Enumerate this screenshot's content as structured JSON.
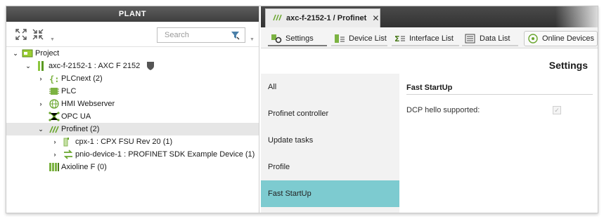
{
  "plant": {
    "title": "PLANT",
    "search_placeholder": "Search",
    "tree": [
      {
        "label": "Project",
        "icon": "project-icon",
        "toggle": "expanded"
      },
      {
        "label": "axc-f-2152-1 : AXC F 2152",
        "icon": "controller-icon",
        "toggle": "expanded",
        "badge": "shield-icon"
      },
      {
        "label": "PLCnext (2)",
        "icon": "plcnext-icon",
        "toggle": "collapsed"
      },
      {
        "label": "PLC",
        "icon": "plc-chip-icon",
        "toggle": "none"
      },
      {
        "label": "HMI Webserver",
        "icon": "globe-icon",
        "toggle": "collapsed"
      },
      {
        "label": "OPC UA",
        "icon": "opcua-icon",
        "toggle": "none"
      },
      {
        "label": "Profinet (2)",
        "icon": "profinet-icon",
        "toggle": "expanded",
        "selected": true
      },
      {
        "label": "cpx-1 : CPX FSU Rev 20 (1)",
        "icon": "cpx-device-icon",
        "toggle": "collapsed"
      },
      {
        "label": "pnio-device-1 : PROFINET SDK Example Device (1)",
        "icon": "pnio-device-icon",
        "toggle": "collapsed"
      },
      {
        "label": "Axioline F (0)",
        "icon": "axioline-icon",
        "toggle": "none"
      }
    ]
  },
  "editor": {
    "tab_label": "axc-f-2152-1 / Profinet",
    "tab_close": "✕",
    "toolbar": {
      "settings": "Settings",
      "device_list": "Device List",
      "interface_list": "Interface List",
      "data_list": "Data List",
      "online_devices": "Online Devices"
    },
    "settings_title": "Settings",
    "categories": [
      "All",
      "Profinet controller",
      "Update tasks",
      "Profile",
      "Fast StartUp"
    ],
    "active_category": "Fast StartUp",
    "section_title": "Fast StartUp",
    "fields": [
      {
        "label": "DCP hello supported:",
        "checked": true,
        "disabled": true
      }
    ]
  },
  "colors": {
    "active_category": "#7dcbd0",
    "header_bg": "#3f3f3f",
    "accent_green": "#4a9c7a"
  }
}
